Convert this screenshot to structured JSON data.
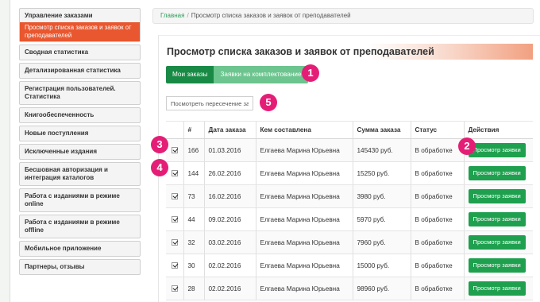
{
  "sidebar": {
    "group": {
      "title": "Управление заказами",
      "active_sub": "Просмотр списка заказов и заявок от преподавателей"
    },
    "items": [
      "Сводная статистика",
      "Детализированная статистика",
      "Регистрация пользователей. Статистика",
      "Книгообеспеченность",
      "Новые поступления",
      "Исключенные издания",
      "Бесшовная авторизация и интеграция каталогов",
      "Работа с изданиями в режиме online",
      "Работа с изданиями в режиме offline",
      "Мобильное приложение",
      "Партнеры, отзывы"
    ]
  },
  "breadcrumb": {
    "home": "Главная",
    "separator": "/",
    "current": "Просмотр списка заказов и заявок от преподавателей"
  },
  "panel": {
    "title": "Просмотр списка заказов и заявок от преподавателей",
    "tabs": [
      "Мои заказы",
      "Заявки на комплектование"
    ],
    "search_placeholder": "Посмотреть пересечение заявок"
  },
  "badges": {
    "b1": "1",
    "b2": "2",
    "b3": "3",
    "b4": "4",
    "b5": "5"
  },
  "table": {
    "headers": [
      "",
      "#",
      "Дата заказа",
      "Кем составлена",
      "Сумма заказа",
      "Статус",
      "Действия"
    ],
    "action_label": "Просмотр заявки",
    "rows": [
      {
        "id": "166",
        "date": "01.03.2016",
        "author": "Елгаева Марина Юрьевна",
        "sum": "145430 руб.",
        "status": "В обработке"
      },
      {
        "id": "144",
        "date": "26.02.2016",
        "author": "Елгаева Марина Юрьевна",
        "sum": "15250 руб.",
        "status": "В обработке"
      },
      {
        "id": "73",
        "date": "16.02.2016",
        "author": "Елгаева Марина Юрьевна",
        "sum": "3980 руб.",
        "status": "В обработке"
      },
      {
        "id": "44",
        "date": "09.02.2016",
        "author": "Елгаева Марина Юрьевна",
        "sum": "5970 руб.",
        "status": "В обработке"
      },
      {
        "id": "32",
        "date": "03.02.2016",
        "author": "Елгаева Марина Юрьевна",
        "sum": "7960 руб.",
        "status": "В обработке"
      },
      {
        "id": "30",
        "date": "02.02.2016",
        "author": "Елгаева Марина Юрьевна",
        "sum": "15000 руб.",
        "status": "В обработке"
      },
      {
        "id": "28",
        "date": "02.02.2016",
        "author": "Елгаева Марина Юрьевна",
        "sum": "98960 руб.",
        "status": "В обработке"
      }
    ]
  },
  "colors": {
    "accent_green": "#1ea04e",
    "active_orange": "#e8572f",
    "badge_pink": "#e41e76"
  }
}
